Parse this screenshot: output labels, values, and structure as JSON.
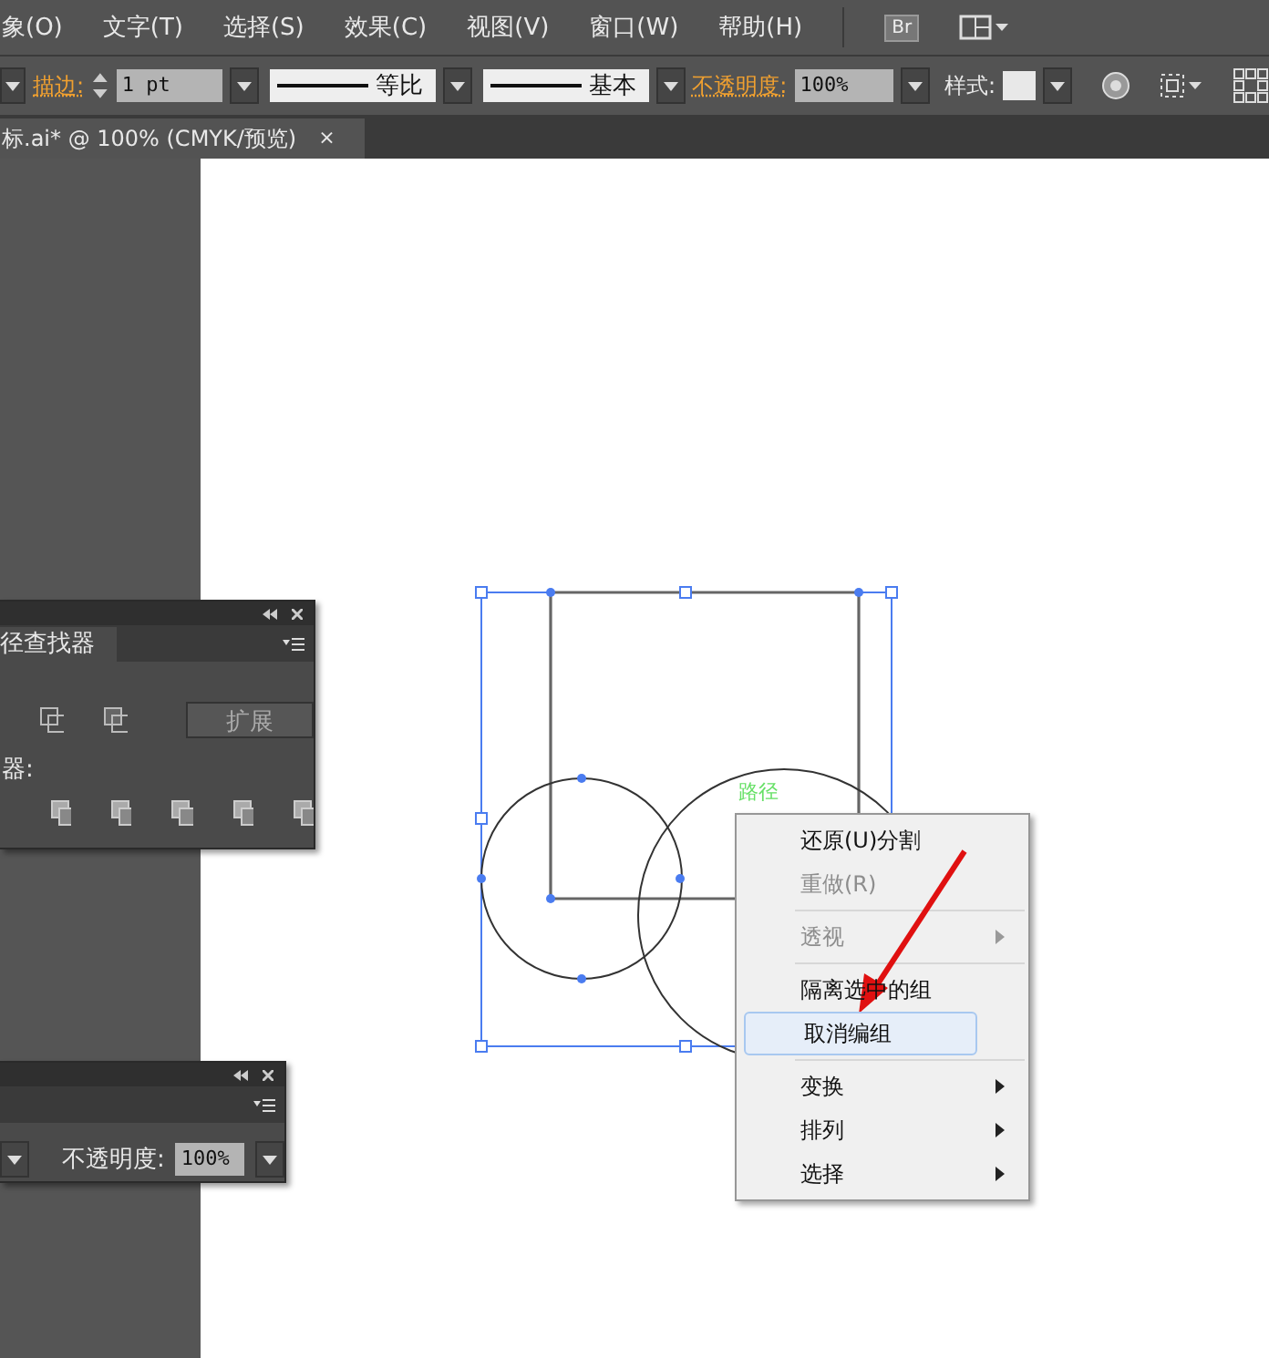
{
  "menu_bar": {
    "items": [
      "象(O)",
      "文字(T)",
      "选择(S)",
      "效果(C)",
      "视图(V)",
      "窗口(W)",
      "帮助(H)"
    ],
    "bridge_label": "Br"
  },
  "control_bar": {
    "stroke_label": "描边:",
    "stroke_weight": "1 pt",
    "profile": "等比",
    "brush": "基本",
    "opacity_label": "不透明度:",
    "opacity": "100%",
    "style_label": "样式:"
  },
  "document_tab": {
    "title": "标.ai* @ 100% (CMYK/预览)",
    "close": "×"
  },
  "pathfinder_panel": {
    "tab": "径查找器",
    "expand_button": "扩展",
    "label": "器:"
  },
  "transparency_panel": {
    "opacity_label": "不透明度:",
    "opacity": "100%"
  },
  "canvas": {
    "path_label": "路径"
  },
  "context_menu": {
    "items": [
      {
        "label": "还原(U)分割",
        "disabled": false,
        "selected": false,
        "submenu": false,
        "group_start": false
      },
      {
        "label": "重做(R)",
        "disabled": true,
        "selected": false,
        "submenu": false,
        "group_start": false
      },
      {
        "label": "透视",
        "disabled": true,
        "selected": false,
        "submenu": true,
        "group_start": true
      },
      {
        "label": "隔离选中的组",
        "disabled": false,
        "selected": false,
        "submenu": false,
        "group_start": true
      },
      {
        "label": "取消编组",
        "disabled": false,
        "selected": true,
        "submenu": false,
        "group_start": false
      },
      {
        "label": "变换",
        "disabled": false,
        "selected": false,
        "submenu": true,
        "group_start": true
      },
      {
        "label": "排列",
        "disabled": false,
        "selected": false,
        "submenu": true,
        "group_start": false
      },
      {
        "label": "选择",
        "disabled": false,
        "selected": false,
        "submenu": true,
        "group_start": false
      }
    ]
  }
}
